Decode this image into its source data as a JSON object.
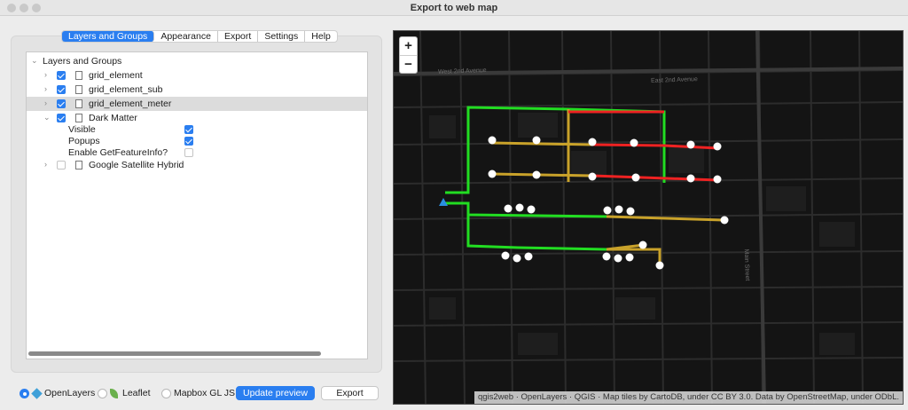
{
  "window": {
    "title": "Export to web map"
  },
  "tabs": [
    "Layers and Groups",
    "Appearance",
    "Export",
    "Settings",
    "Help"
  ],
  "tree": {
    "root_label": "Layers and Groups",
    "layers": [
      {
        "name": "grid_element",
        "checked": true
      },
      {
        "name": "grid_element_sub",
        "checked": true
      },
      {
        "name": "grid_element_meter",
        "checked": true,
        "selected": true
      },
      {
        "name": "Dark Matter",
        "checked": true,
        "expanded": true
      }
    ],
    "dark_matter_options": [
      {
        "label": "Visible",
        "checked": true
      },
      {
        "label": "Popups",
        "checked": true
      },
      {
        "label": "Enable GetFeatureInfo?",
        "checked": false
      }
    ],
    "last_layer": {
      "name": "Google Satellite Hybrid",
      "checked": false
    }
  },
  "renderers": {
    "options": [
      "OpenLayers",
      "Leaflet",
      "Mapbox GL JS"
    ],
    "selected": "OpenLayers"
  },
  "buttons": {
    "update_preview": "Update preview",
    "export": "Export"
  },
  "map": {
    "zoom_in": "+",
    "zoom_out": "−",
    "attribution": "qgis2web · OpenLayers · QGIS · Map tiles by CartoDB, under CC BY 3.0. Data by OpenStreetMap, under ODbL.",
    "streets": [
      "West 2nd Avenue",
      "East 2nd Avenue",
      "Main Street"
    ],
    "colors": {
      "good": "#22dd22",
      "mid": "#c9a22a",
      "bad": "#ee2222",
      "node": "#ffffff",
      "source": "#2a8ee0"
    }
  }
}
